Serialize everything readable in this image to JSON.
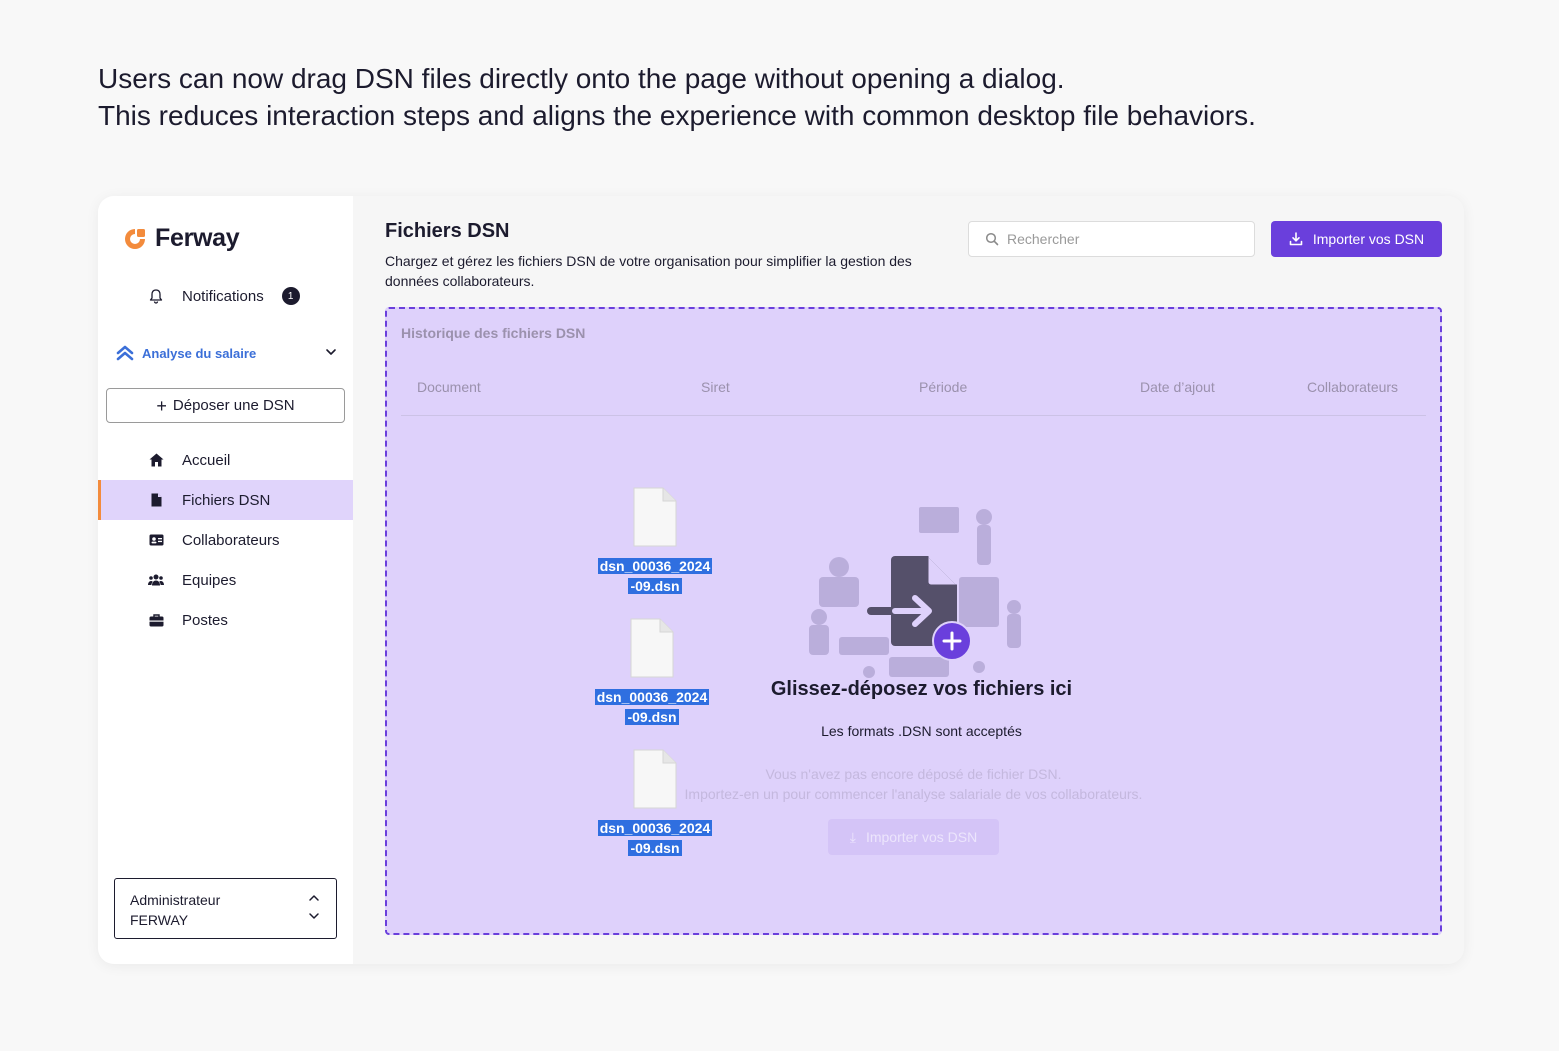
{
  "intro": {
    "line1": "Users can now drag DSN files directly onto the page without opening a dialog.",
    "line2": "This reduces interaction steps and aligns the experience with common desktop file behaviors."
  },
  "sidebar": {
    "logo": "Ferway",
    "notifications": {
      "label": "Notifications",
      "count": "1"
    },
    "section": {
      "label": "Analyse du salaire",
      "expanded": true
    },
    "deposit_button": "Déposer une DSN",
    "nav": [
      {
        "label": "Accueil",
        "icon": "home-icon",
        "active": false
      },
      {
        "label": "Fichiers DSN",
        "icon": "file-icon",
        "active": true
      },
      {
        "label": "Collaborateurs",
        "icon": "id-card-icon",
        "active": false
      },
      {
        "label": "Equipes",
        "icon": "team-icon",
        "active": false
      },
      {
        "label": "Postes",
        "icon": "briefcase-icon",
        "active": false
      }
    ],
    "user": {
      "role": "Administrateur",
      "org": "FERWAY"
    }
  },
  "main": {
    "title": "Fichiers DSN",
    "description": "Chargez et gérez les fichiers DSN de votre organisation pour simplifier la gestion des données collaborateurs.",
    "search_placeholder": "Rechercher",
    "import_button": "Importer vos DSN",
    "history": {
      "title": "Historique des fichiers DSN",
      "columns": [
        "Document",
        "Siret",
        "Période",
        "Date d’ajout",
        "Collaborateurs"
      ],
      "empty_line1": "Vous n'avez pas encore déposé de fichier DSN.",
      "empty_line2": "Importez-en un pour commencer l'analyse salariale de vos collaborateurs.",
      "empty_button": "Importer vos DSN"
    },
    "dropzone": {
      "title": "Glissez-déposez vos fichiers ici",
      "subtitle": "Les formats .DSN sont acceptés"
    },
    "dragged_files": [
      {
        "name_line1": "dsn_00036_2024",
        "name_line2": "-09.dsn"
      },
      {
        "name_line1": "dsn_00036_2024",
        "name_line2": "-09.dsn"
      },
      {
        "name_line1": "dsn_00036_2024",
        "name_line2": "-09.dsn"
      }
    ]
  },
  "colors": {
    "accent": "#6a3fdc",
    "active_nav": "#e0d4fb",
    "active_marker": "#f38b3c",
    "section_link": "#3b6fd8",
    "dropzone_bg": "#ded1fb",
    "selection": "#2f6fe0"
  }
}
